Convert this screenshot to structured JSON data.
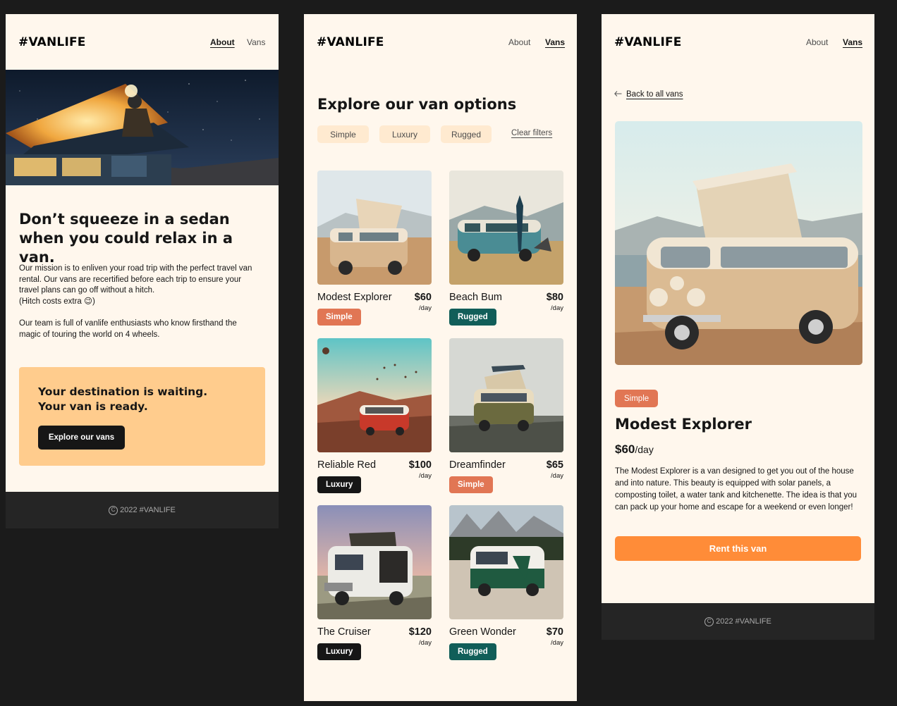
{
  "colors": {
    "background": "#1B1B1B",
    "page": "#FFF7ED",
    "accent_orange": "#FF8C38",
    "simple": "#E17654",
    "rugged": "#115E59",
    "luxury": "#161616",
    "cta_panel": "#FFCC8D",
    "filter_chip": "#FFEAD0",
    "footer": "#252525"
  },
  "brand": "#VANLIFE",
  "nav": {
    "about": "About",
    "vans": "Vans"
  },
  "footer": {
    "text": "2022 #VANLIFE",
    "icon": "copyright-icon"
  },
  "about_page": {
    "headline": "Don’t squeeze in a sedan when you could relax in a van.",
    "mission": "Our mission is to enliven your road trip with the perfect travel van rental. Our vans are recertified before each trip to ensure your travel plans can go off without a hitch.",
    "hitch_note": "(Hitch costs extra 😉)",
    "team": "Our team is full of vanlife enthusiasts who know firsthand the magic of touring the world on 4 wheels.",
    "cta_line1": "Your destination is waiting.",
    "cta_line2": "Your van is ready.",
    "cta_button": "Explore our vans"
  },
  "vans_page": {
    "title": "Explore our van options",
    "filters": [
      "Simple",
      "Luxury",
      "Rugged"
    ],
    "clear_filters": "Clear filters",
    "per_day": "/day",
    "vans": [
      {
        "name": "Modest Explorer",
        "price": "$60",
        "type": "Simple"
      },
      {
        "name": "Beach Bum",
        "price": "$80",
        "type": "Rugged"
      },
      {
        "name": "Reliable Red",
        "price": "$100",
        "type": "Luxury"
      },
      {
        "name": "Dreamfinder",
        "price": "$65",
        "type": "Simple"
      },
      {
        "name": "The Cruiser",
        "price": "$120",
        "type": "Luxury"
      },
      {
        "name": "Green Wonder",
        "price": "$70",
        "type": "Rugged"
      }
    ]
  },
  "detail_page": {
    "back": "Back to all vans",
    "badge": "Simple",
    "name": "Modest Explorer",
    "price": "$60",
    "price_unit": "/day",
    "description": "The Modest Explorer is a van designed to get you out of the house and into nature. This beauty is equipped with solar panels, a composting toilet, a water tank and kitchenette. The idea is that you can pack up your home and escape for a weekend or even longer!",
    "button": "Rent this van"
  }
}
